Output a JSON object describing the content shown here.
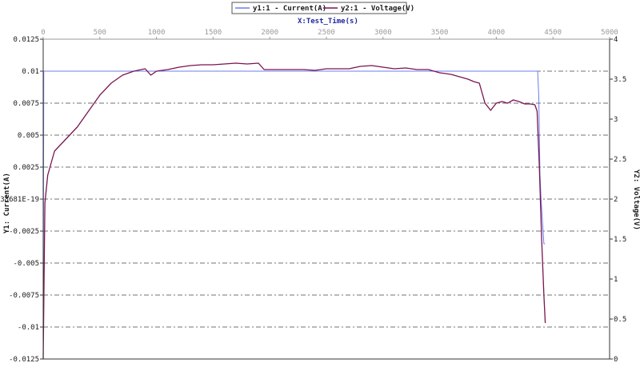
{
  "chart_data": {
    "type": "line",
    "x_title": "X:Test_Time(s)",
    "y1_label": "Y1: Current(A)",
    "y2_label": "Y2: Voltage(V)",
    "x_ticks": [
      "0",
      "500",
      "1000",
      "1500",
      "2000",
      "2500",
      "3000",
      "3500",
      "4000",
      "4500",
      "5000"
    ],
    "y1_ticks": [
      "0.0125",
      "0.01",
      "0.0075",
      "0.005",
      "0.0025",
      "4.33681E-19",
      "-0.0025",
      "-0.005",
      "-0.0075",
      "-0.01",
      "-0.0125"
    ],
    "y2_ticks": [
      "4",
      "3.5",
      "3",
      "2.5",
      "2",
      "1.5",
      "1",
      "0.5",
      "0"
    ],
    "xlim": [
      0,
      5000
    ],
    "y1lim": [
      -0.0125,
      0.0125
    ],
    "y2lim": [
      0,
      4
    ],
    "grid": true,
    "legend_position": "top-center",
    "series": [
      {
        "name": "y1:1 - Current(A)",
        "axis": "y1",
        "color": "#6b7cf0",
        "x": [
          0,
          5,
          10,
          4365,
          4375,
          4385,
          4395,
          4420,
          4430
        ],
        "y": [
          -0.0125,
          0.01,
          0.01,
          0.01,
          0.008,
          0.002,
          0.0,
          -0.0035,
          -0.0035
        ]
      },
      {
        "name": "y2:1 - Voltage(V)",
        "axis": "y2",
        "color": "#7a1450",
        "x": [
          0,
          15,
          40,
          100,
          200,
          300,
          400,
          500,
          600,
          700,
          800,
          900,
          950,
          1000,
          1100,
          1200,
          1300,
          1400,
          1500,
          1600,
          1700,
          1800,
          1900,
          1950,
          2000,
          2100,
          2200,
          2300,
          2400,
          2500,
          2600,
          2700,
          2800,
          2900,
          3000,
          3100,
          3200,
          3300,
          3400,
          3500,
          3600,
          3700,
          3750,
          3800,
          3850,
          3900,
          3950,
          4000,
          4050,
          4100,
          4150,
          4200,
          4250,
          4300,
          4340,
          4360,
          4380,
          4400,
          4420,
          4432
        ],
        "y": [
          0.0,
          1.95,
          2.3,
          2.6,
          2.75,
          2.9,
          3.1,
          3.3,
          3.45,
          3.55,
          3.6,
          3.63,
          3.55,
          3.6,
          3.62,
          3.65,
          3.67,
          3.68,
          3.68,
          3.69,
          3.7,
          3.69,
          3.7,
          3.62,
          3.62,
          3.62,
          3.62,
          3.62,
          3.61,
          3.63,
          3.63,
          3.63,
          3.66,
          3.67,
          3.65,
          3.63,
          3.64,
          3.62,
          3.62,
          3.58,
          3.56,
          3.52,
          3.5,
          3.47,
          3.45,
          3.2,
          3.11,
          3.2,
          3.22,
          3.2,
          3.24,
          3.22,
          3.19,
          3.19,
          3.18,
          3.1,
          2.4,
          1.5,
          0.8,
          0.45
        ]
      }
    ]
  }
}
